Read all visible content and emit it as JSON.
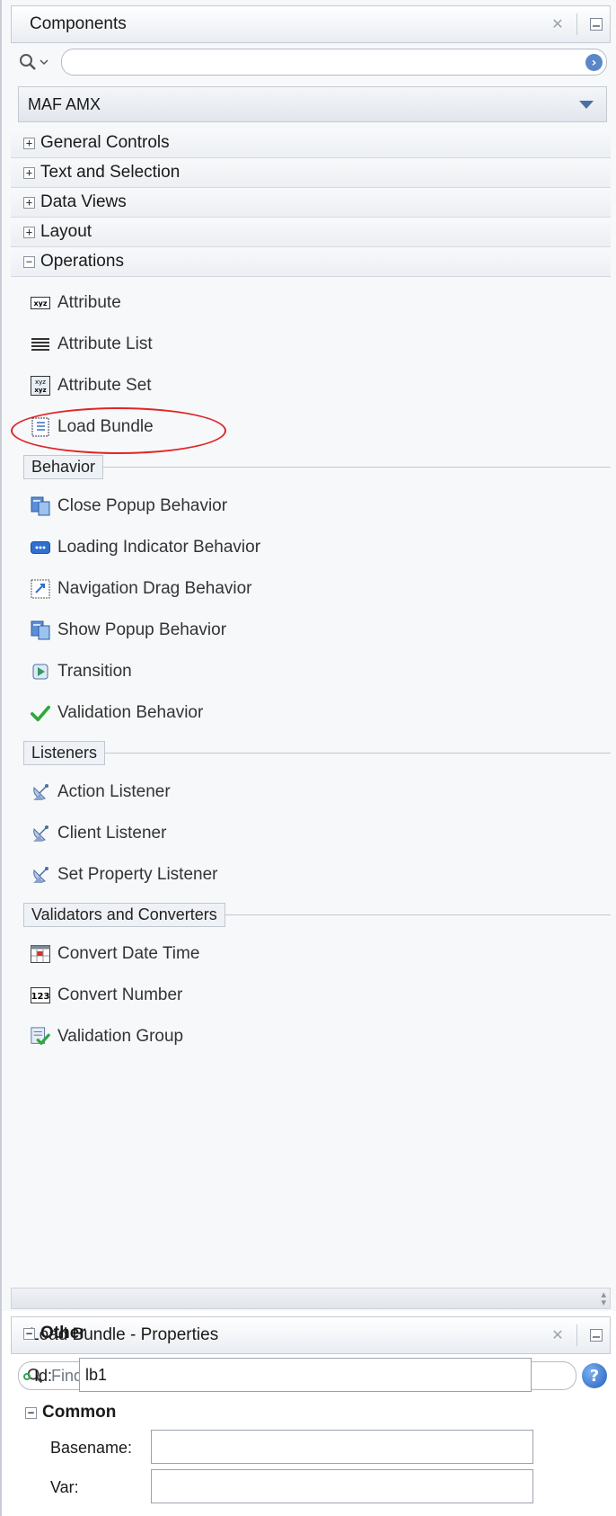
{
  "components": {
    "title": "Components",
    "library": "MAF AMX",
    "sections": [
      {
        "label": "General Controls",
        "state": "+"
      },
      {
        "label": "Text and Selection",
        "state": "+"
      },
      {
        "label": "Data Views",
        "state": "+"
      },
      {
        "label": "Layout",
        "state": "+"
      },
      {
        "label": "Operations",
        "state": "−"
      }
    ],
    "operations": [
      "Attribute",
      "Attribute List",
      "Attribute Set",
      "Load Bundle"
    ],
    "behavior_label": "Behavior",
    "behavior": [
      "Close Popup Behavior",
      "Loading Indicator Behavior",
      "Navigation Drag Behavior",
      "Show Popup Behavior",
      "Transition",
      "Validation Behavior"
    ],
    "listeners_label": "Listeners",
    "listeners": [
      "Action Listener",
      "Client Listener",
      "Set Property Listener"
    ],
    "validators_label": "Validators and Converters",
    "validators": [
      "Convert Date Time",
      "Convert Number",
      "Validation Group"
    ]
  },
  "properties": {
    "title": "Load Bundle - Properties",
    "find_placeholder": "Find",
    "common_label": "Common",
    "basename_label": "Basename:",
    "basename_value": "",
    "var_label": "Var:",
    "var_value": "",
    "other_label": "Other",
    "id_label": "Id:",
    "id_value": "lb1"
  },
  "colors": {
    "highlight": "#e12525",
    "accent": "#5c87c7"
  }
}
